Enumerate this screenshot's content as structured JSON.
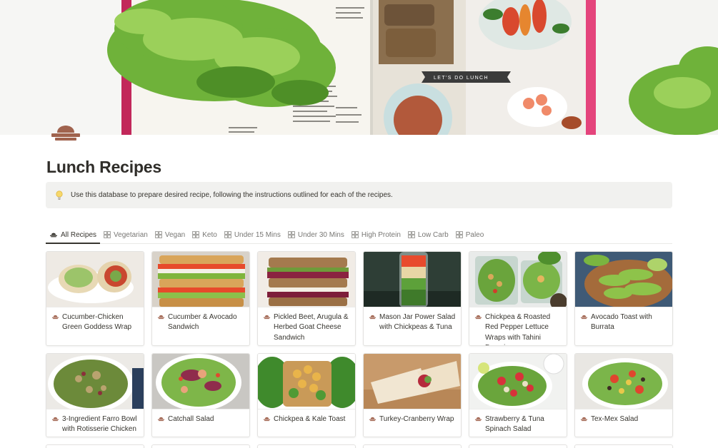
{
  "page": {
    "title": "Lunch Recipes",
    "icon": "recipe-dish-icon",
    "cover_banner_text": "LET'S DO LUNCH"
  },
  "callout": {
    "icon": "lightbulb-icon",
    "text": "Use this database to prepare desired recipe, following the instructions outlined for each of the recipes."
  },
  "tabs": [
    {
      "label": "All Recipes",
      "icon": "dish-icon",
      "active": true
    },
    {
      "label": "Vegetarian",
      "icon": "gallery-view-icon"
    },
    {
      "label": "Vegan",
      "icon": "gallery-view-icon"
    },
    {
      "label": "Keto",
      "icon": "gallery-view-icon"
    },
    {
      "label": "Under 15 Mins",
      "icon": "gallery-view-icon"
    },
    {
      "label": "Under 30 Mins",
      "icon": "gallery-view-icon"
    },
    {
      "label": "High Protein",
      "icon": "gallery-view-icon"
    },
    {
      "label": "Low Carb",
      "icon": "gallery-view-icon"
    },
    {
      "label": "Paleo",
      "icon": "gallery-view-icon"
    }
  ],
  "recipes": [
    {
      "name": "Cucumber-Chicken Green Goddess Wrap",
      "icon": "dish-icon",
      "image": "wrap-photo"
    },
    {
      "name": "Cucumber & Avocado Sandwich",
      "icon": "dish-icon",
      "image": "sandwich-photo"
    },
    {
      "name": "Pickled Beet, Arugula & Herbed Goat Cheese Sandwich",
      "icon": "dish-icon",
      "image": "beet-sandwich-photo"
    },
    {
      "name": "Mason Jar Power Salad with Chickpeas & Tuna",
      "icon": "dish-icon",
      "image": "mason-jar-photo"
    },
    {
      "name": "Chickpea & Roasted Red Pepper Lettuce Wraps with Tahini Dressing",
      "icon": "dish-icon",
      "image": "lettuce-wrap-photo"
    },
    {
      "name": "Avocado Toast with Burrata",
      "icon": "dish-icon",
      "image": "avocado-toast-photo"
    },
    {
      "name": "3-Ingredient Farro Bowl with Rotisserie Chicken",
      "icon": "dish-icon",
      "image": "farro-bowl-photo"
    },
    {
      "name": "Catchall Salad",
      "icon": "dish-icon",
      "image": "catchall-salad-photo"
    },
    {
      "name": "Chickpea & Kale Toast",
      "icon": "dish-icon",
      "image": "kale-toast-photo"
    },
    {
      "name": "Turkey-Cranberry Wrap",
      "icon": "dish-icon",
      "image": "turkey-wrap-photo"
    },
    {
      "name": "Strawberry & Tuna Spinach Salad",
      "icon": "dish-icon",
      "image": "strawberry-salad-photo"
    },
    {
      "name": "Tex-Mex Salad",
      "icon": "dish-icon",
      "image": "texmex-salad-photo"
    }
  ],
  "colors": {
    "accent_brown": "#a0634e",
    "callout_bg": "#f1f1ef",
    "text": "#37352f",
    "muted": "#787774"
  }
}
